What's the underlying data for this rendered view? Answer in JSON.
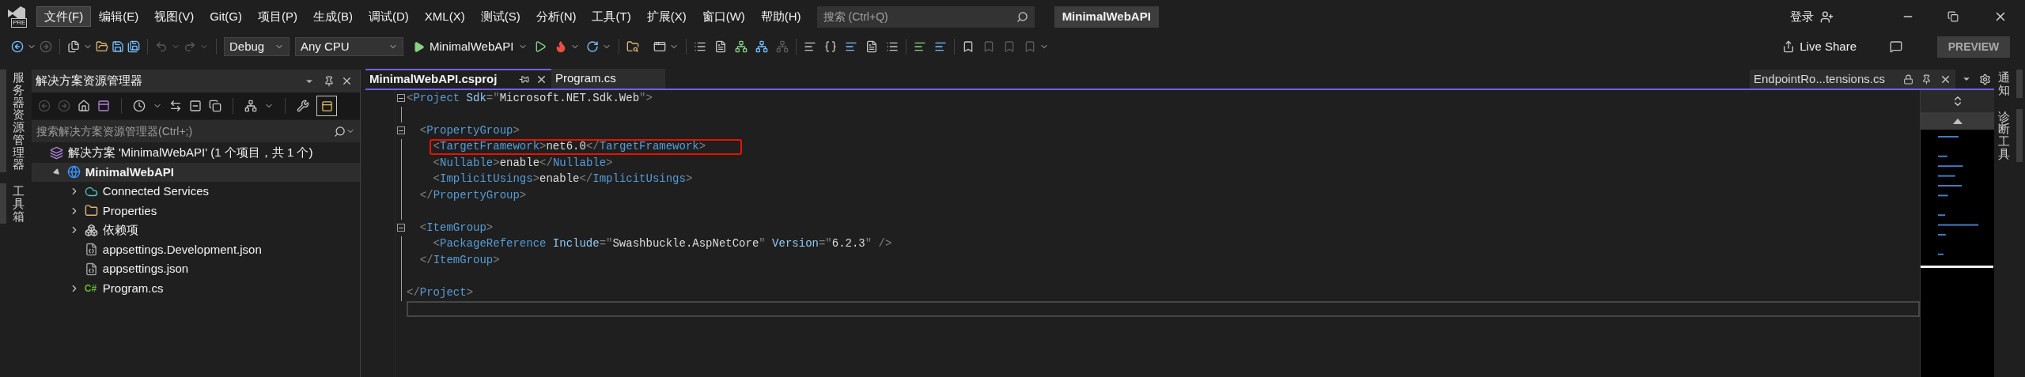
{
  "menu": {
    "logo_badge": "PRE",
    "items": [
      {
        "label": "文件(F)",
        "selected": true
      },
      {
        "label": "编辑(E)",
        "selected": false
      },
      {
        "label": "视图(V)",
        "selected": false
      },
      {
        "label": "Git(G)",
        "selected": false
      },
      {
        "label": "项目(P)",
        "selected": false
      },
      {
        "label": "生成(B)",
        "selected": false
      },
      {
        "label": "调试(D)",
        "selected": false
      },
      {
        "label": "XML(X)",
        "selected": false
      },
      {
        "label": "测试(S)",
        "selected": false
      },
      {
        "label": "分析(N)",
        "selected": false
      },
      {
        "label": "工具(T)",
        "selected": false
      },
      {
        "label": "扩展(X)",
        "selected": false
      },
      {
        "label": "窗口(W)",
        "selected": false
      },
      {
        "label": "帮助(H)",
        "selected": false
      }
    ]
  },
  "search": {
    "placeholder": "搜索 (Ctrl+Q)"
  },
  "solution_title": "MinimalWebAPI",
  "sign_in": "登录",
  "toolbar": {
    "configuration": "Debug",
    "platform": "Any CPU",
    "startup": "MinimalWebAPI",
    "live_share": "Live Share",
    "preview": "PREVIEW"
  },
  "left_strip": [
    {
      "label": "服务器资源管理器"
    },
    {
      "label": "工具箱"
    }
  ],
  "right_strip": [
    {
      "label": "通知"
    },
    {
      "label": "诊断工具"
    }
  ],
  "solution_explorer": {
    "title": "解决方案资源管理器",
    "search": {
      "placeholder": "搜索解决方案资源管理器(Ctrl+;)"
    },
    "tree": [
      {
        "kind": "solution",
        "label": "解决方案 'MinimalWebAPI' (1 个项目，共 1 个)",
        "selected": false,
        "children": [
          {
            "kind": "project",
            "label": "MinimalWebAPI",
            "expandable": true,
            "expanded": true,
            "selected": true,
            "children": [
              {
                "kind": "services",
                "label": "Connected Services",
                "expandable": true,
                "expanded": false,
                "selected": false
              },
              {
                "kind": "properties",
                "label": "Properties",
                "expandable": true,
                "expanded": false,
                "selected": false
              },
              {
                "kind": "dependencies",
                "label": "依赖项",
                "expandable": true,
                "expanded": false,
                "selected": false
              },
              {
                "kind": "json",
                "label": "appsettings.Development.json",
                "expandable": false,
                "expanded": false,
                "selected": false
              },
              {
                "kind": "json",
                "label": "appsettings.json",
                "expandable": false,
                "expanded": false,
                "selected": false
              },
              {
                "kind": "csharp",
                "icon_text": "C#",
                "label": "Program.cs",
                "expandable": true,
                "expanded": false,
                "selected": false
              }
            ]
          }
        ]
      }
    ]
  },
  "editor": {
    "tabs": [
      {
        "label": "MinimalWebAPI.csproj",
        "selected": true
      },
      {
        "label": "Program.cs",
        "selected": false
      }
    ],
    "pinned_tab": {
      "label": "EndpointRo...tensions.cs"
    },
    "lines": [
      {
        "fold": true,
        "highlighted": false,
        "current": false,
        "tokens": [
          {
            "kind": "punct",
            "text": "<"
          },
          {
            "kind": "tag",
            "text": "Project"
          },
          {
            "kind": "attr",
            "text": " Sdk"
          },
          {
            "kind": "punct",
            "text": "=\""
          },
          {
            "kind": "value",
            "text": "Microsoft.NET.Sdk.Web"
          },
          {
            "kind": "punct",
            "text": "\">"
          }
        ]
      },
      {
        "fold": false,
        "highlighted": false,
        "current": false
      },
      {
        "fold": true,
        "highlighted": false,
        "current": false,
        "tokens": [
          {
            "kind": "punct",
            "text": "  <"
          },
          {
            "kind": "tag",
            "text": "PropertyGroup"
          },
          {
            "kind": "punct",
            "text": ">"
          }
        ]
      },
      {
        "fold": false,
        "highlighted": true,
        "current": false,
        "tokens": [
          {
            "kind": "punct",
            "text": "    <"
          },
          {
            "kind": "tag",
            "text": "TargetFramework"
          },
          {
            "kind": "punct",
            "text": ">"
          },
          {
            "kind": "text",
            "text": "net6.0"
          },
          {
            "kind": "punct",
            "text": "</"
          },
          {
            "kind": "tag",
            "text": "TargetFramework"
          },
          {
            "kind": "punct",
            "text": ">"
          }
        ]
      },
      {
        "fold": false,
        "highlighted": false,
        "current": false,
        "tokens": [
          {
            "kind": "punct",
            "text": "    <"
          },
          {
            "kind": "tag",
            "text": "Nullable"
          },
          {
            "kind": "punct",
            "text": ">"
          },
          {
            "kind": "text",
            "text": "enable"
          },
          {
            "kind": "punct",
            "text": "</"
          },
          {
            "kind": "tag",
            "text": "Nullable"
          },
          {
            "kind": "punct",
            "text": ">"
          }
        ]
      },
      {
        "fold": false,
        "highlighted": false,
        "current": false,
        "tokens": [
          {
            "kind": "punct",
            "text": "    <"
          },
          {
            "kind": "tag",
            "text": "ImplicitUsings"
          },
          {
            "kind": "punct",
            "text": ">"
          },
          {
            "kind": "text",
            "text": "enable"
          },
          {
            "kind": "punct",
            "text": "</"
          },
          {
            "kind": "tag",
            "text": "ImplicitUsings"
          },
          {
            "kind": "punct",
            "text": ">"
          }
        ]
      },
      {
        "fold": false,
        "highlighted": false,
        "current": false,
        "tokens": [
          {
            "kind": "punct",
            "text": "  </"
          },
          {
            "kind": "tag",
            "text": "PropertyGroup"
          },
          {
            "kind": "punct",
            "text": ">"
          }
        ]
      },
      {
        "fold": false,
        "highlighted": false,
        "current": false
      },
      {
        "fold": true,
        "highlighted": false,
        "current": false,
        "tokens": [
          {
            "kind": "punct",
            "text": "  <"
          },
          {
            "kind": "tag",
            "text": "ItemGroup"
          },
          {
            "kind": "punct",
            "text": ">"
          }
        ]
      },
      {
        "fold": false,
        "highlighted": false,
        "current": false,
        "tokens": [
          {
            "kind": "punct",
            "text": "    <"
          },
          {
            "kind": "tag",
            "text": "PackageReference"
          },
          {
            "kind": "attr",
            "text": " Include"
          },
          {
            "kind": "punct",
            "text": "=\""
          },
          {
            "kind": "value",
            "text": "Swashbuckle.AspNetCore"
          },
          {
            "kind": "punct",
            "text": "\""
          },
          {
            "kind": "attr",
            "text": " Version"
          },
          {
            "kind": "punct",
            "text": "=\""
          },
          {
            "kind": "value",
            "text": "6.2.3"
          },
          {
            "kind": "punct",
            "text": "\" />"
          }
        ]
      },
      {
        "fold": false,
        "highlighted": false,
        "current": false,
        "tokens": [
          {
            "kind": "punct",
            "text": "  </"
          },
          {
            "kind": "tag",
            "text": "ItemGroup"
          },
          {
            "kind": "punct",
            "text": ">"
          }
        ]
      },
      {
        "fold": false,
        "highlighted": false,
        "current": false
      },
      {
        "fold": false,
        "highlighted": false,
        "current": false,
        "tokens": [
          {
            "kind": "punct",
            "text": "</"
          },
          {
            "kind": "tag",
            "text": "Project"
          },
          {
            "kind": "punct",
            "text": ">"
          }
        ]
      },
      {
        "fold": false,
        "highlighted": false,
        "current": true
      }
    ]
  }
}
